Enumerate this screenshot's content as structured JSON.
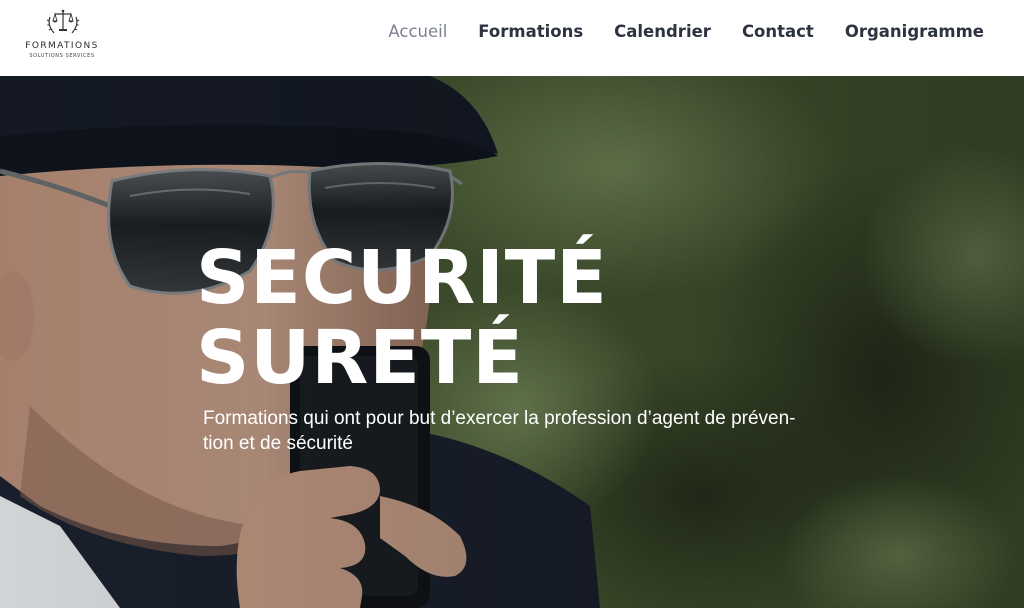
{
  "header": {
    "logo": {
      "icon": "scales-of-justice-icon",
      "title": "FORMATIONS",
      "subtitle": "SOLUTIONS SERVICES"
    },
    "nav": [
      {
        "label": "Accueil",
        "active": true
      },
      {
        "label": "Formations",
        "active": false
      },
      {
        "label": "Calendrier",
        "active": false
      },
      {
        "label": "Contact",
        "active": false
      },
      {
        "label": "Organigramme",
        "active": false
      }
    ]
  },
  "hero": {
    "title_line1": "SECURITÉ",
    "title_line2": "SURETÉ",
    "description_line1": "Formations qui ont pour but d’exercer la profession d’agent de préven-",
    "description_line2": "tion et de sécurité",
    "image": "security-agent-with-radio-photo"
  },
  "colors": {
    "nav_text": "#2d3440",
    "nav_active": "#7b8190",
    "hero_text": "#ffffff",
    "hero_foliage": "#4b5f35"
  }
}
